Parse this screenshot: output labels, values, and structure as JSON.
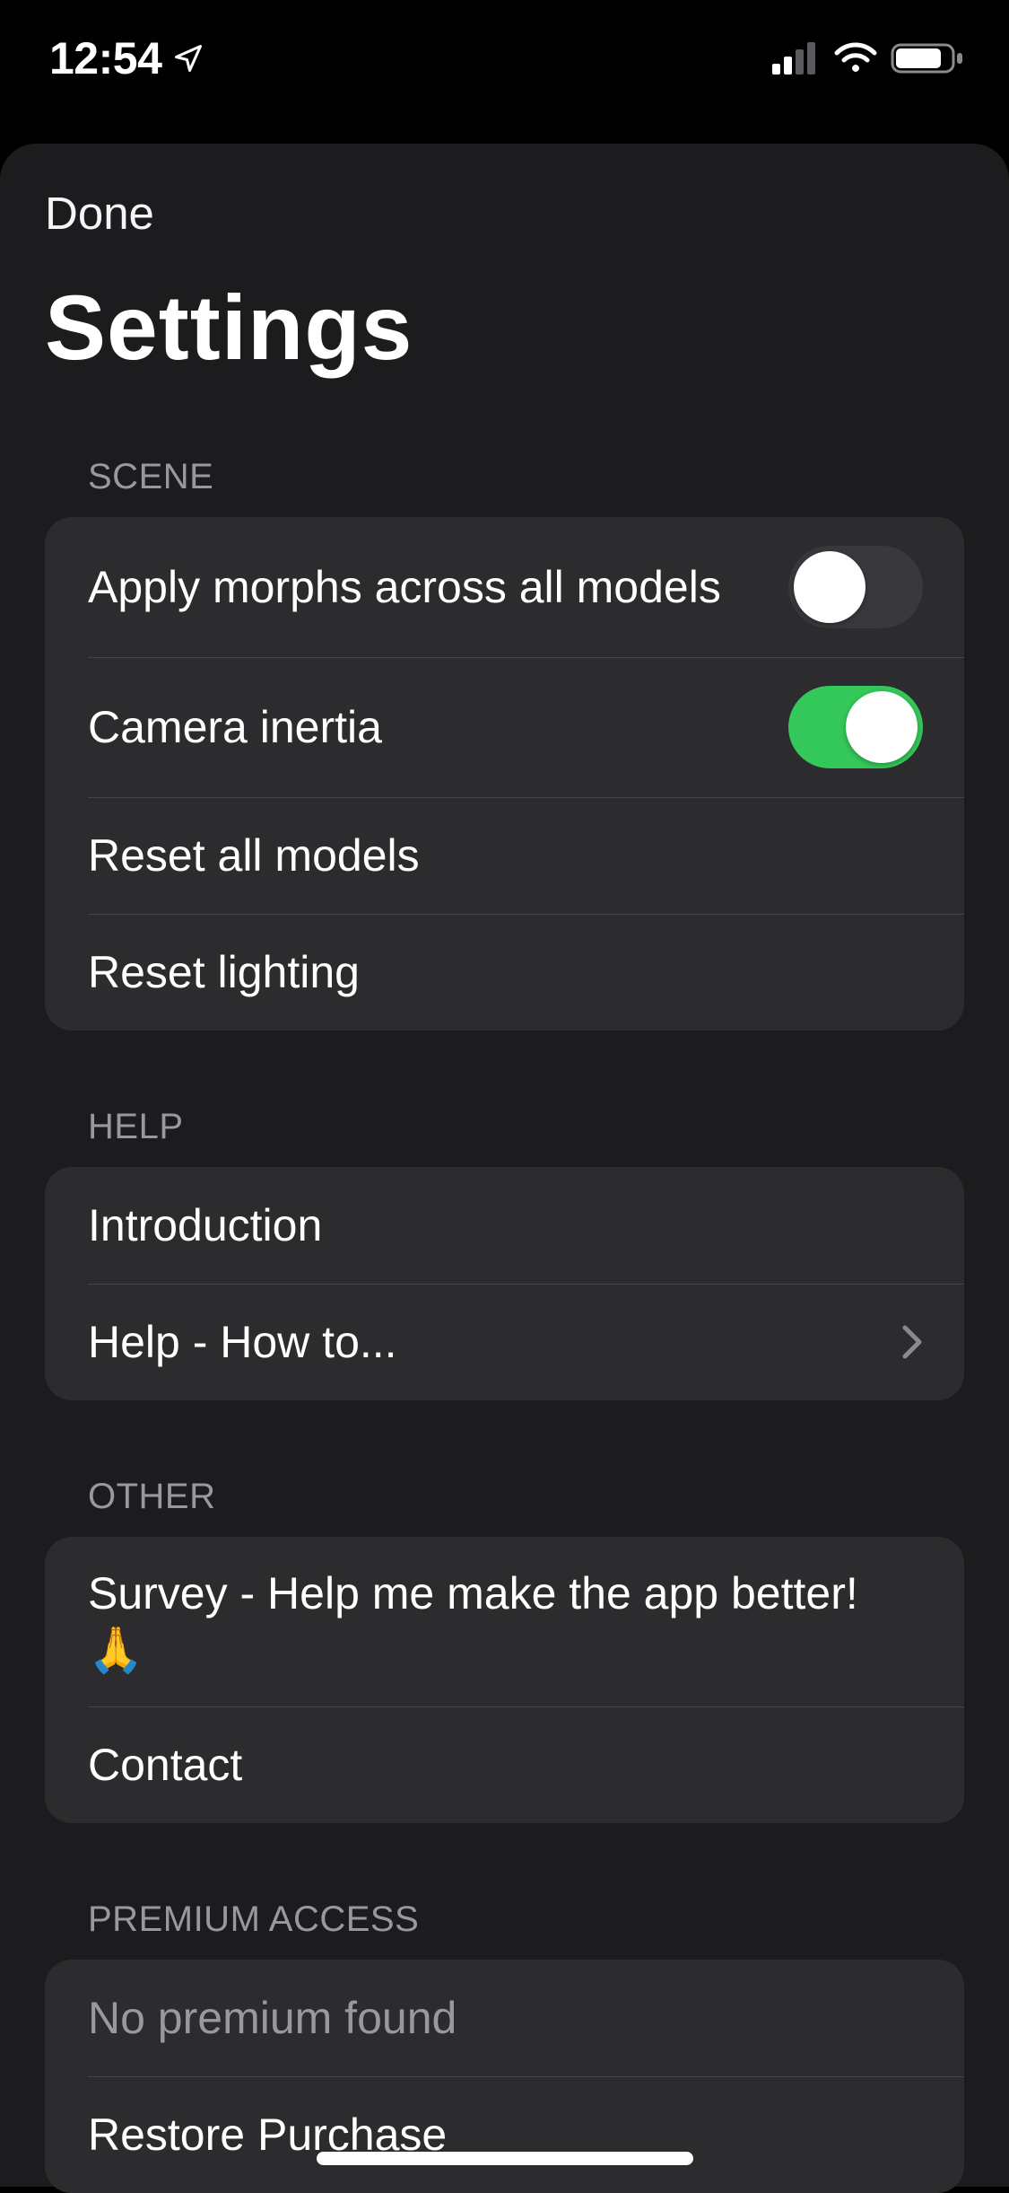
{
  "status": {
    "time": "12:54"
  },
  "nav": {
    "done_label": "Done",
    "title": "Settings"
  },
  "sections": {
    "scene": {
      "header": "SCENE",
      "apply_morphs_label": "Apply morphs across all models",
      "apply_morphs_on": false,
      "camera_inertia_label": "Camera inertia",
      "camera_inertia_on": true,
      "reset_models_label": "Reset all models",
      "reset_lighting_label": "Reset lighting"
    },
    "help": {
      "header": "HELP",
      "introduction_label": "Introduction",
      "howto_label": "Help - How to..."
    },
    "other": {
      "header": "OTHER",
      "survey_label": "Survey - Help me make the app better! 🙏",
      "contact_label": "Contact"
    },
    "premium": {
      "header": "PREMIUM ACCESS",
      "status_label": "No premium found",
      "restore_label": "Restore Purchase"
    }
  }
}
